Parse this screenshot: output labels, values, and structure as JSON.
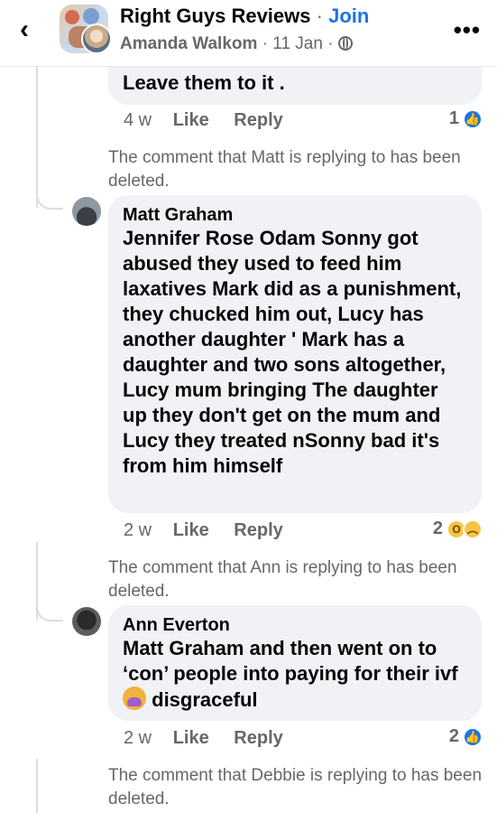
{
  "header": {
    "group_name": "Right Guys Reviews",
    "separator": "·",
    "join_label": "Join",
    "author": "Amanda Walkom",
    "date": "11 Jan",
    "back_icon": "chevron-left-icon",
    "more_icon": "more-dots-icon",
    "privacy_icon": "globe-icon"
  },
  "comments": [
    {
      "text": "Leave them to it .",
      "time": "4 w",
      "like_label": "Like",
      "reply_label": "Reply",
      "reaction_count": "1",
      "reactions": [
        "like"
      ]
    },
    {
      "deleted_notice": "The comment that Matt is replying to has been deleted.",
      "author": "Matt Graham",
      "text": "Jennifer Rose Odam Sonny got abused they used to feed him laxatives Mark did as a punishment, they chucked him out, Lucy has another daughter ' Mark has a daughter and two sons altogether, Lucy mum bringing The daughter up they don't get on the mum and Lucy they treated nSonny bad it's from him himself",
      "time": "2 w",
      "like_label": "Like",
      "reply_label": "Reply",
      "reaction_count": "2",
      "reactions": [
        "wow",
        "sad"
      ]
    },
    {
      "deleted_notice": "The comment that Ann is replying to has been deleted.",
      "author": "Ann Everton",
      "text_before": "Matt Graham and then went on to ‘con’ people into paying for their ivf",
      "text_after": "disgraceful",
      "emoji": "facepalm",
      "time": "2 w",
      "like_label": "Like",
      "reply_label": "Reply",
      "reaction_count": "2",
      "reactions": [
        "like"
      ]
    },
    {
      "deleted_notice": "The comment that Debbie is replying to has been deleted."
    }
  ]
}
